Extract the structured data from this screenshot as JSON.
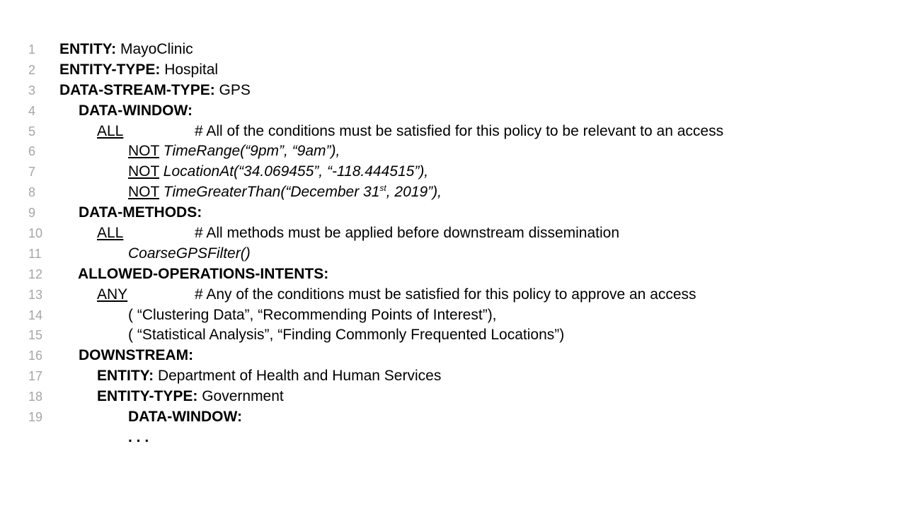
{
  "lines": [
    {
      "n": "1",
      "key": "ENTITY:",
      "val": "MayoClinic"
    },
    {
      "n": "2",
      "key": "ENTITY-TYPE:",
      "val": "Hospital"
    },
    {
      "n": "3",
      "key": "DATA-STREAM-TYPE:",
      "val": "GPS"
    },
    {
      "n": "4",
      "key": "DATA-WINDOW:"
    },
    {
      "n": "5",
      "op": "ALL",
      "comment": "# All of the conditions must be satisfied for this policy to be relevant to an access"
    },
    {
      "n": "6",
      "op": "NOT",
      "expr": "TimeRange(“9pm”, “9am”),"
    },
    {
      "n": "7",
      "op": "NOT",
      "expr": "LocationAt(“34.069455”, “-118.444515”),"
    },
    {
      "n": "8",
      "op": "NOT",
      "expr_a": "TimeGreaterThan(“December 31",
      "expr_sup": "st",
      "expr_b": ", 2019”),"
    },
    {
      "n": "9",
      "key": "DATA-METHODS:"
    },
    {
      "n": "10",
      "op": "ALL ",
      "comment": "# All methods must be applied before downstream dissemination"
    },
    {
      "n": "11",
      "expr": "CoarseGPSFilter()"
    },
    {
      "n": "12",
      "key": "ALLOWED-OPERATIONS-INTENTS:"
    },
    {
      "n": "13",
      "op": "ANY",
      "comment": "# Any of the conditions must be satisfied for this policy to approve an access"
    },
    {
      "n": "14",
      "text": "( “Clustering Data”, “Recommending Points of Interest”),"
    },
    {
      "n": "15",
      "text": "( “Statistical Analysis”, “Finding Commonly Frequented Locations”)"
    },
    {
      "n": "16",
      "key": "DOWNSTREAM:"
    },
    {
      "n": "17",
      "key": "ENTITY:",
      "val": "Department of Health and Human Services"
    },
    {
      "n": "18",
      "key": "ENTITY-TYPE:",
      "val": "Government"
    },
    {
      "n": "19",
      "key": "DATA-WINDOW:"
    },
    {
      "n": "",
      "key": ". . ."
    }
  ]
}
